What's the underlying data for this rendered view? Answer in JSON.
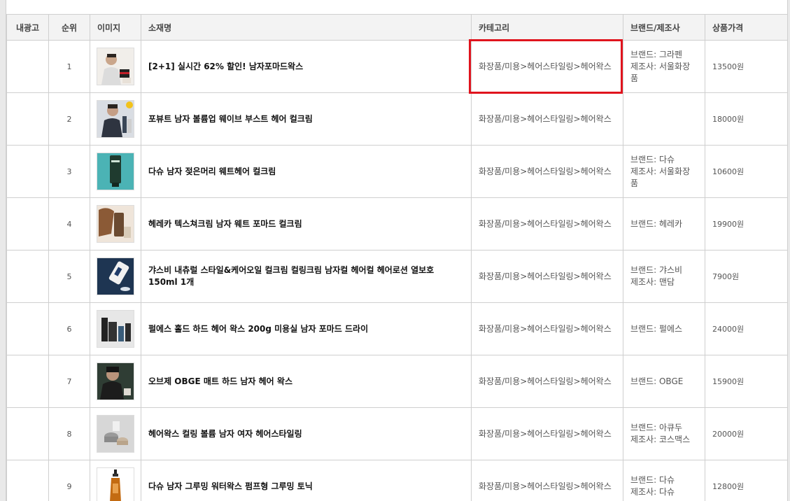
{
  "header": {
    "ad": "내광고",
    "rank": "순위",
    "image": "이미지",
    "name": "소재명",
    "category": "카테고리",
    "brand": "브랜드/제조사",
    "price": "상품가격"
  },
  "highlight_color": "#e0141e",
  "rows": [
    {
      "rank": "1",
      "name": "[2+1] 실시간 62% 할인! 남자포마드왁스",
      "category": "화장품/미용>헤어스타일링>헤어왁스",
      "brand": "브랜드: 그라펜",
      "maker": "제조사: 서울화장품",
      "price": "13500원",
      "thumb": "model-photo-with-jars",
      "highlighted": true
    },
    {
      "rank": "2",
      "name": "포뷰트 남자 볼륨업 웨이브 부스트 헤어 컬크림",
      "category": "화장품/미용>헤어스타일링>헤어왁스",
      "brand": "",
      "maker": "",
      "price": "18000원",
      "thumb": "model-photo-with-tubes"
    },
    {
      "rank": "3",
      "name": "다슈 남자 젖은머리 웨트헤어 컬크림",
      "category": "화장품/미용>헤어스타일링>헤어왁스",
      "brand": "브랜드: 다슈",
      "maker": "제조사: 서울화장품",
      "price": "10600원",
      "thumb": "green-tube-on-teal"
    },
    {
      "rank": "4",
      "name": "헤레카 텍스쳐크림 남자 웨트 포마드 컬크림",
      "category": "화장품/미용>헤어스타일링>헤어왁스",
      "brand": "브랜드: 헤레카",
      "maker": "",
      "price": "19900원",
      "thumb": "brown-tube-on-wood"
    },
    {
      "rank": "5",
      "name": "갸스비 내츄럴 스타일&케어오일 컬크림 컬링크림 남자컬 헤어컬 헤어로션 열보호 150ml 1개",
      "category": "화장품/미용>헤어스타일링>헤어왁스",
      "brand": "브랜드: 갸스비",
      "maker": "제조사: 맨담",
      "price": "7900원",
      "thumb": "white-bottle-on-navy"
    },
    {
      "rank": "6",
      "name": "펄에스 홀드 하드 헤어 왁스 200g 미용실 남자 포마드 드라이",
      "category": "화장품/미용>헤어스타일링>헤어왁스",
      "brand": "브랜드: 펄에스",
      "maker": "",
      "price": "24000원",
      "thumb": "black-bottles-set"
    },
    {
      "rank": "7",
      "name": "오브제 OBGE 매트 하드 남자 헤어 왁스",
      "category": "화장품/미용>헤어스타일링>헤어왁스",
      "brand": "브랜드: OBGE",
      "maker": "",
      "price": "15900원",
      "thumb": "model-photo-dark"
    },
    {
      "rank": "8",
      "name": "헤어왁스 컬링 볼륨 남자 여자 헤어스타일링",
      "category": "화장품/미용>헤어스타일링>헤어왁스",
      "brand": "브랜드: 아큐두",
      "maker": "제조사: 코스맥스",
      "price": "20000원",
      "thumb": "wax-jars-grey"
    },
    {
      "rank": "9",
      "name": "다슈 남자 그루밍 워터왁스 펌프형 그루밍 토닉",
      "category": "화장품/미용>헤어스타일링>헤어왁스",
      "brand": "브랜드: 다슈",
      "maker": "제조사: 다슈",
      "price": "12800원",
      "thumb": "amber-pump-bottle"
    }
  ]
}
